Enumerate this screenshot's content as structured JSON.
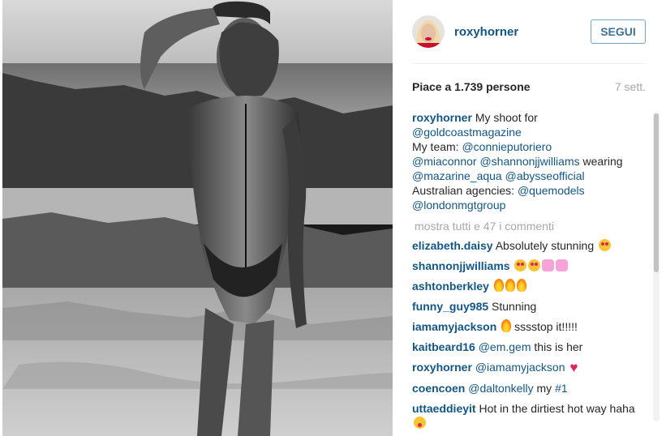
{
  "post": {
    "username": "roxyhorner",
    "follow_label": "SEGUI",
    "likes": "Piace a 1.739 persone",
    "time": "7 sett."
  },
  "caption": {
    "user": "roxyhorner",
    "line1": "My shoot for",
    "line2": "@goldcoastmagazine",
    "line3_prefix": "My team: ",
    "line3_mention": "@connieputoriero",
    "line4_mention1": "@miaconnor",
    "line4_mention2": "@shannonjjwilliams",
    "line4_suffix": " wearing",
    "line5_mention1": "@mazarine_aqua",
    "line5_mention2": "@abysseofficial",
    "line6_prefix": "Australian agencies: ",
    "line6_mention": "@quemodels",
    "line7_mention": "@londonmgtgroup"
  },
  "more_comments": "mostra tutti e 47 i commenti",
  "comments": [
    {
      "user": "elizabeth.daisy",
      "text": "Absolutely stunning",
      "emoji": "heart-eyes-icon"
    },
    {
      "user": "shannonjjwilliams",
      "text": "",
      "emoji": "heart-eyes-pink-hearts-icons"
    },
    {
      "user": "ashtonberkley",
      "text": "",
      "emoji": "fire-icons"
    },
    {
      "user": "funny_guy985",
      "text": "Stunning",
      "emoji": ""
    },
    {
      "user": "iamamyjackson",
      "text": "sssstop it!!!!!",
      "emoji": "fire-icon"
    },
    {
      "user": "kaitbeard16",
      "mention": "@em.gem",
      "text": " this is her",
      "emoji": ""
    },
    {
      "user": "roxyhorner",
      "mention": "@iamamyjackson",
      "text": "",
      "emoji": "red-heart-icon"
    },
    {
      "user": "coencoen",
      "mention": "@daltonkelly",
      "text": " my ",
      "hashtag": "#1",
      "emoji": ""
    },
    {
      "user": "uttaeddieyit",
      "text": "Hot in the dirtiest hot way haha",
      "emoji": "tongue-icon"
    }
  ],
  "colors": {
    "accent": "#125688",
    "muted": "#a5a7aa",
    "follow_border": "#70a6c9"
  }
}
